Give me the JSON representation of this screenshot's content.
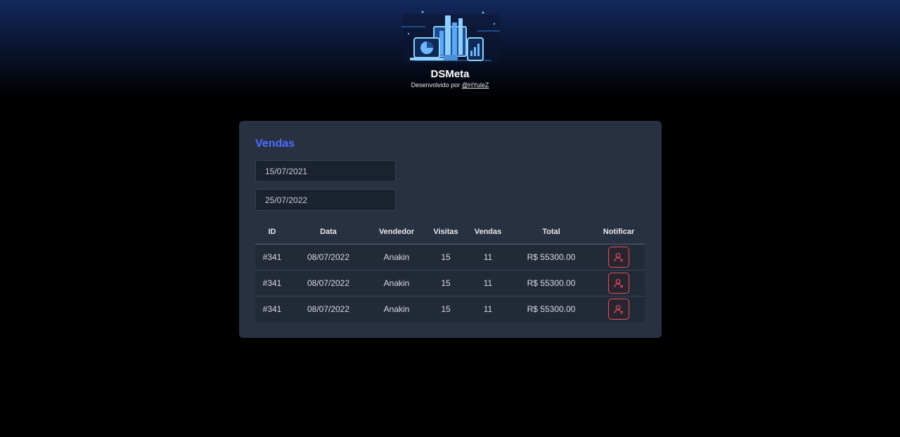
{
  "brand": {
    "title": "DSMeta",
    "subtitle_prefix": "Desenvolvido por ",
    "author_link": "@HYuleZ"
  },
  "sales_card": {
    "title": "Vendas",
    "date_from": "15/07/2021",
    "date_to": "25/07/2022",
    "columns": [
      "ID",
      "Data",
      "Vendedor",
      "Visitas",
      "Vendas",
      "Total",
      "Notificar"
    ],
    "rows": [
      [
        "#341",
        "08/07/2022",
        "Anakin",
        "15",
        "11",
        "R$ 55300.00"
      ],
      [
        "#341",
        "08/07/2022",
        "Anakin",
        "15",
        "11",
        "R$ 55300.00"
      ],
      [
        "#341",
        "08/07/2022",
        "Anakin",
        "15",
        "11",
        "R$ 55300.00"
      ]
    ],
    "notify_icon": "user-notify-icon"
  },
  "colors": {
    "header_top": "#13285c",
    "background": "#000000",
    "card": "#283142",
    "accent": "#4d6dff",
    "notify": "#e0545b"
  }
}
